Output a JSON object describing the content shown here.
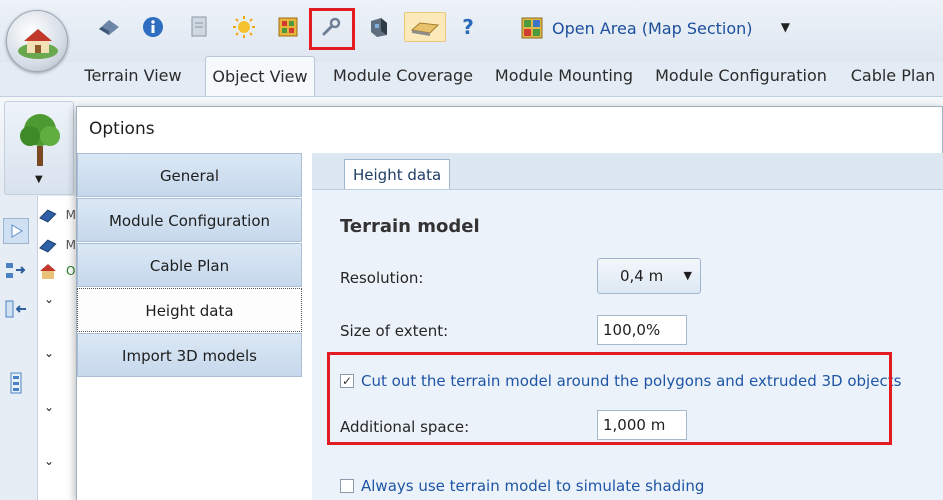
{
  "toolbar": {
    "area_select_label": "Open Area (Map Section)",
    "help_glyph": "?",
    "icons": [
      "eraser-icon",
      "info-icon",
      "page-icon",
      "sun-icon",
      "grid-icon",
      "wrench-icon",
      "device-icon",
      "terrain-icon",
      "help-icon"
    ]
  },
  "tabs": [
    {
      "label": "Terrain View"
    },
    {
      "label": "Object View"
    },
    {
      "label": "Module Coverage"
    },
    {
      "label": "Module Mounting"
    },
    {
      "label": "Module Configuration"
    },
    {
      "label": "Cable Plan"
    }
  ],
  "tree": {
    "row_letters": [
      "M",
      "M",
      "O"
    ]
  },
  "dialog": {
    "title": "Options",
    "nav_items": [
      {
        "label": "General"
      },
      {
        "label": "Module Configuration"
      },
      {
        "label": "Cable Plan"
      },
      {
        "label": "Height data"
      },
      {
        "label": "Import 3D models"
      }
    ],
    "active_tab": "Height data",
    "section_heading": "Terrain model",
    "resolution": {
      "label": "Resolution:",
      "value": "0,4 m"
    },
    "extent": {
      "label": "Size of extent:",
      "value": "100,0%"
    },
    "cutout": {
      "label": "Cut out the terrain model around the polygons and extruded 3D objects",
      "checked": true
    },
    "additional_space": {
      "label": "Additional space:",
      "value": "1,000 m"
    },
    "shading": {
      "label": "Always use terrain model to simulate shading",
      "checked": false
    }
  },
  "colors": {
    "highlight": "#e31b23",
    "link_blue": "#1e55a5",
    "nav_gradient_top": "#dbe8f5",
    "panel_bg": "#ecf2f9"
  }
}
